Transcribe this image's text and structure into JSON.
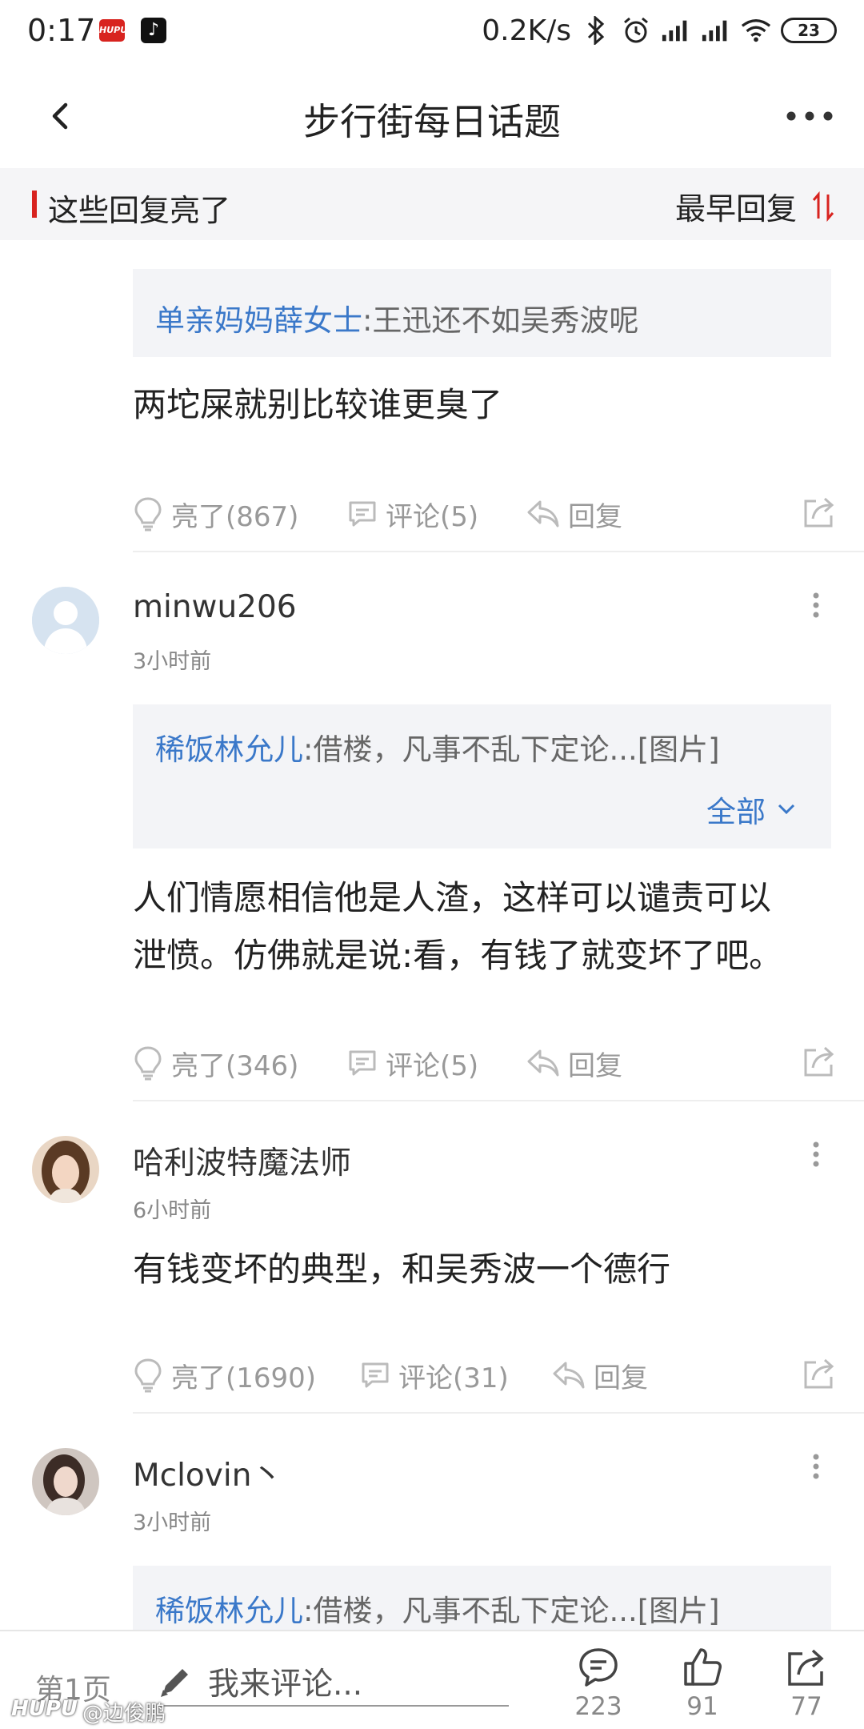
{
  "status_bar": {
    "time": "0:17",
    "hupu_badge": "HUPU",
    "network_speed": "0.2K/s",
    "battery": "23"
  },
  "header": {
    "title": "步行街每日话题"
  },
  "section": {
    "title": "这些回复亮了",
    "sort_label": "最早回复"
  },
  "comments": [
    {
      "quote_author": "单亲妈妈薛女士",
      "quote_text": ":王迅还不如吴秀波呢",
      "body": "两坨屎就别比较谁更臭了",
      "likes": "亮了(867)",
      "replies": "评论(5)",
      "reply_label": "回复"
    },
    {
      "username": "minwu206",
      "time": "3小时前",
      "quote_author": "稀饭林允儿",
      "quote_text": ":借楼，凡事不乱下定论...[图片]",
      "quote_expand": "全部",
      "body_line1": "人们情愿相信他是人渣，这样可以谴责可以",
      "body_line2": "泄愤。仿佛就是说:看，有钱了就变坏了吧。",
      "likes": "亮了(346)",
      "replies": "评论(5)",
      "reply_label": "回复"
    },
    {
      "username": "哈利波特魔法师",
      "time": "6小时前",
      "body": "有钱变坏的典型，和吴秀波一个德行",
      "likes": "亮了(1690)",
      "replies": "评论(31)",
      "reply_label": "回复"
    },
    {
      "username": "Mclovin丶",
      "time": "3小时前",
      "quote_author": "稀饭林允儿",
      "quote_text": ":借楼，凡事不乱下定论...[图片]"
    }
  ],
  "bottom_bar": {
    "page": "第1页",
    "input_placeholder": "我来评论...",
    "comment_count": "223",
    "like_count": "91",
    "share_count": "77"
  },
  "watermark": {
    "logo": "HUPU",
    "handle": "@边俊鹏"
  },
  "colors": {
    "accent_red": "#d8231f",
    "link_blue": "#3a78c9",
    "section_bg": "#f5f5f7",
    "quote_bg": "#f3f4f7"
  },
  "icons": [
    "back-arrow-icon",
    "more-dots-icon",
    "sort-icon",
    "lightbulb-icon",
    "comment-icon",
    "reply-icon",
    "share-icon",
    "pencil-icon",
    "thumbs-up-icon"
  ]
}
